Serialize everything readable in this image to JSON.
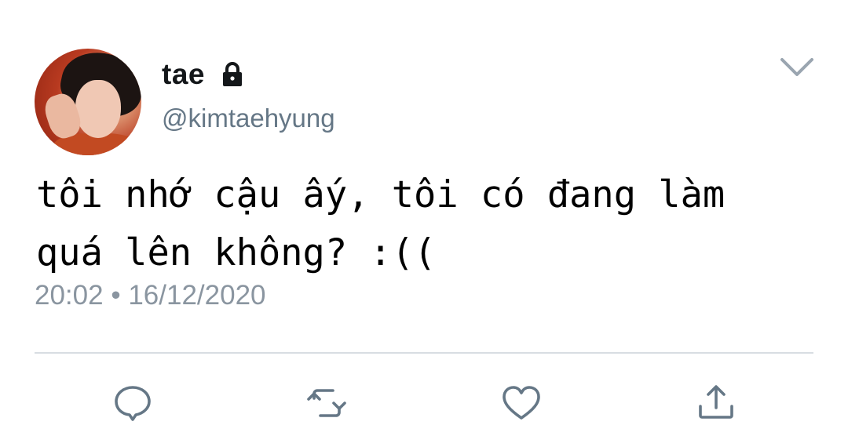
{
  "author": {
    "display_name": "tae",
    "handle": "@kimtaehyung",
    "protected_icon": "lock-icon",
    "avatar": "profile-photo"
  },
  "tweet": {
    "text": "tôi nhớ cậu ấy, tôi có đang làm\nquá lên không? :((",
    "time": "20:02",
    "separator": "•",
    "date": "16/12/2020"
  },
  "menu": {
    "icon": "chevron-down-icon"
  },
  "actions": [
    {
      "name": "reply",
      "icon": "speech-bubble-icon"
    },
    {
      "name": "retweet",
      "icon": "retweet-arrows-icon"
    },
    {
      "name": "like",
      "icon": "heart-icon"
    },
    {
      "name": "share",
      "icon": "share-upload-icon"
    }
  ],
  "colors": {
    "text_primary": "#14171a",
    "text_secondary": "#657786",
    "timestamp": "#8a95a0",
    "icon": "#657786",
    "divider": "#d8dde2"
  }
}
